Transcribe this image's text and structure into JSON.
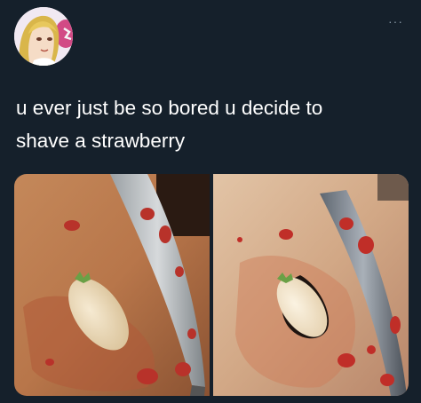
{
  "tweet": {
    "line1": "u ever just be so bored u decide to",
    "line2": "shave a strawberry"
  },
  "header": {
    "more_label": "···"
  },
  "media": {
    "photo_count": 2,
    "photos": [
      {
        "subject": "shaved strawberry beside kitchen knife on wooden cutting board"
      },
      {
        "subject": "shaved strawberry beside kitchen knife on wooden cutting board"
      }
    ]
  },
  "colors": {
    "background": "#15202b",
    "text": "#ffffff",
    "muted": "#8899a6"
  },
  "icons": [
    "avatar-image",
    "more-options-icon"
  ]
}
